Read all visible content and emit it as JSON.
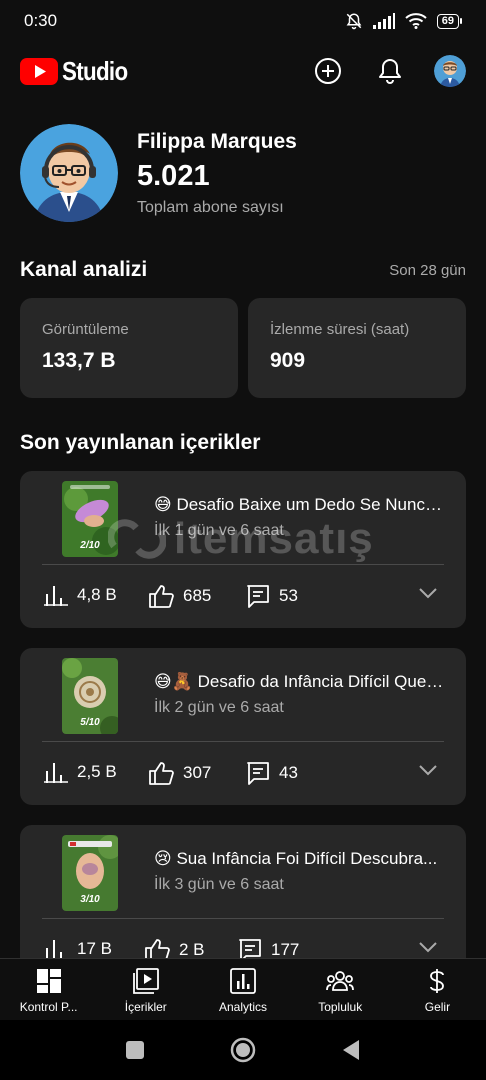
{
  "status_bar": {
    "time": "0:30",
    "battery": "69"
  },
  "app": {
    "logo_text": "Studio",
    "brand_color": "#ff0000"
  },
  "channel": {
    "name": "Filippa Marques",
    "subscribers": "5.021",
    "subscribers_label": "Toplam abone sayısı"
  },
  "analytics": {
    "title": "Kanal analizi",
    "period": "Son 28 gün",
    "views_label": "Görüntüleme",
    "views_value": "133,7 B",
    "watch_label": "İzlenme süresi (saat)",
    "watch_value": "909"
  },
  "recent": {
    "title": "Son yayınlanan içerikler",
    "items": [
      {
        "title": "😅 Desafio Baixe um Dedo Se Nunca...",
        "age": "İlk 1 gün ve 6 saat",
        "thumb_label": "2/10",
        "views": "4,8 B",
        "likes": "685",
        "comments": "53"
      },
      {
        "title": "😅🧸 Desafio da Infância Difícil Quem...",
        "age": "İlk 2 gün ve 6 saat",
        "thumb_label": "5/10",
        "views": "2,5 B",
        "likes": "307",
        "comments": "43"
      },
      {
        "title": "😢 Sua Infância Foi Difícil Descubra...",
        "age": "İlk 3 gün ve 6 saat",
        "thumb_label": "3/10",
        "views": "17 B",
        "likes": "2 B",
        "comments": "177"
      }
    ]
  },
  "watermark": {
    "text": "itemsatış"
  },
  "nav": {
    "dashboard": "Kontrol P...",
    "content": "İçerikler",
    "analytics": "Analytics",
    "community": "Topluluk",
    "earn": "Gelir"
  }
}
